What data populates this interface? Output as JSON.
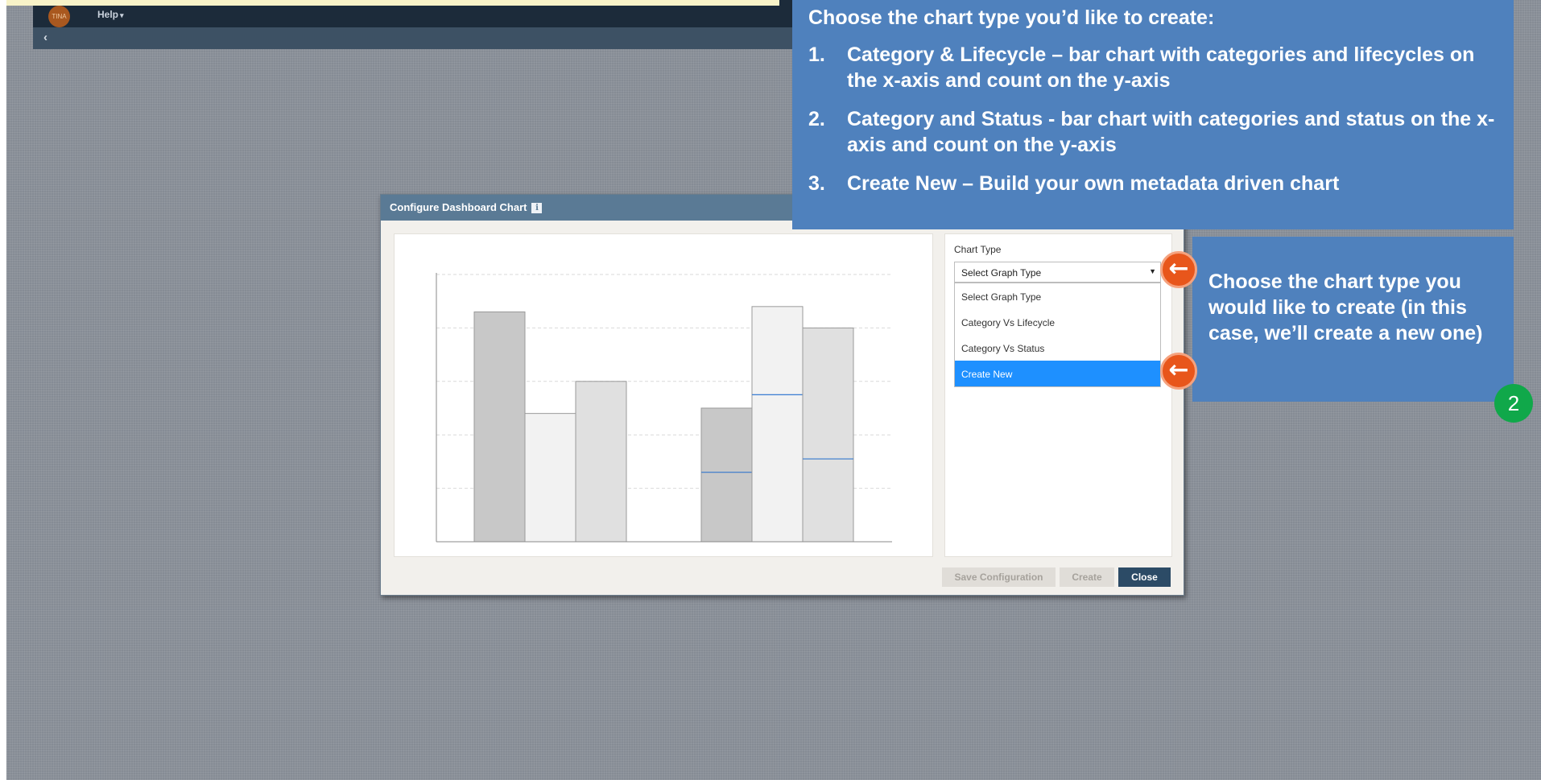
{
  "nav": {
    "logo_text": "TINA",
    "help_label": "Help",
    "caret_icon": "caret-down-icon",
    "back_icon": "chevron-left-icon"
  },
  "dialog": {
    "title": "Configure Dashboard Chart",
    "info_icon_glyph": "i",
    "chart_type_label": "Chart Type",
    "selected_value": "Select Graph Type",
    "options": [
      "Select Graph Type",
      "Category Vs Lifecycle",
      "Category Vs Status",
      "Create New"
    ],
    "highlighted_option": "Create New",
    "buttons": {
      "save": "Save Configuration",
      "create": "Create",
      "close": "Close"
    }
  },
  "preview_chart": {
    "type": "bar",
    "note": "placeholder preview with no labels",
    "groups": [
      {
        "bars": [
          {
            "segments": [
              0.86
            ]
          },
          {
            "segments": [
              0.48
            ]
          },
          {
            "segments": [
              0.6
            ]
          }
        ]
      },
      {
        "bars": [
          {
            "segments": [
              0.26,
              0.24
            ]
          },
          {
            "segments": [
              0.55,
              0.33
            ]
          },
          {
            "segments": [
              0.31,
              0.49
            ]
          }
        ]
      }
    ],
    "colors": [
      "#c8c8c8",
      "#f2f2f2",
      "#e0e0e0"
    ],
    "divider_color": "#3b7fd4"
  },
  "callouts": {
    "top_title": "Choose the chart type you’d like to create:",
    "steps": [
      {
        "num": "1.",
        "text": "Category & Lifecycle – bar chart with categories and lifecycles on the x-axis and count on the y-axis"
      },
      {
        "num": "2.",
        "text": "Category and Status - bar chart with categories and status on the x-axis and count on the y-axis"
      },
      {
        "num": "3.",
        "text": "Create New – Build your own metadata driven chart"
      }
    ],
    "side_text": "Choose the chart type you would like to create (in this case, we’ll create a new one)",
    "arrow_icon": "arrow-left-icon",
    "step_badge": "2"
  },
  "colors": {
    "callout_blue": "#4f81bd",
    "dialog_header": "#5a7a95",
    "highlight": "#1e90ff",
    "arrow_orange": "#e8561b",
    "badge_green": "#10a84a"
  }
}
